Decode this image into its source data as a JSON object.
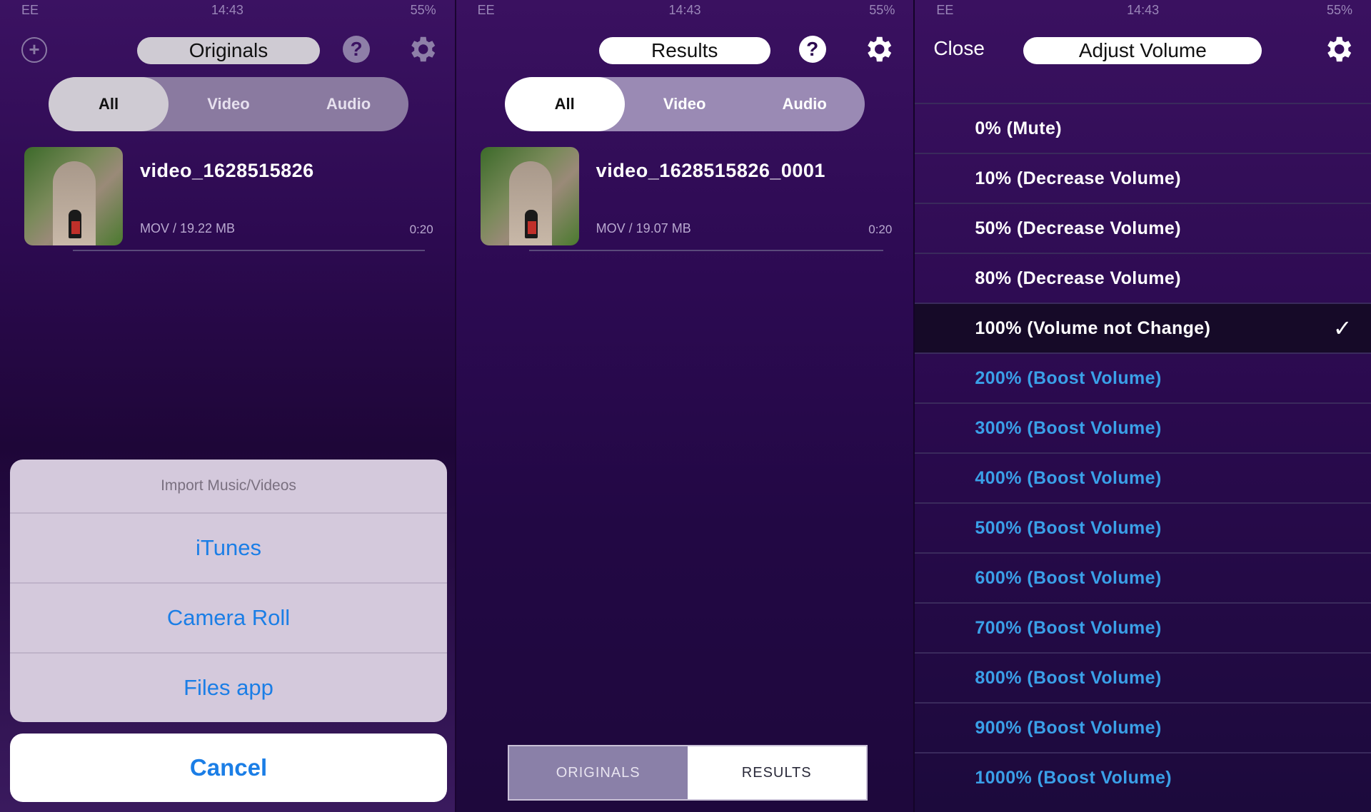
{
  "status_bar": {
    "carrier": "EE",
    "time": "14:43",
    "battery": "55%"
  },
  "panel1": {
    "title": "Originals",
    "add_icon": "plus-circle-icon",
    "help_icon": "question-circle-icon",
    "settings_icon": "gear-icon",
    "segments": [
      "All",
      "Video",
      "Audio"
    ],
    "media": {
      "name": "video_1628515826",
      "meta": "MOV / 19.22 MB",
      "duration": "0:20"
    },
    "action_sheet": {
      "title": "Import Music/Videos",
      "items": [
        "iTunes",
        "Camera Roll",
        "Files app"
      ],
      "cancel": "Cancel"
    }
  },
  "panel2": {
    "title": "Results",
    "help_icon": "question-circle-icon",
    "settings_icon": "gear-icon",
    "segments": [
      "All",
      "Video",
      "Audio"
    ],
    "media": {
      "name": "video_1628515826_0001",
      "meta": "MOV / 19.07 MB",
      "duration": "0:20"
    },
    "bottom_tabs": [
      "ORIGINALS",
      "RESULTS"
    ]
  },
  "panel3": {
    "close": "Close",
    "title": "Adjust Volume",
    "settings_icon": "gear-icon",
    "selected_index": 4,
    "check_icon": "checkmark-icon",
    "options": [
      "0% (Mute)",
      "10% (Decrease Volume)",
      "50% (Decrease Volume)",
      "80% (Decrease Volume)",
      "100% (Volume not Change)",
      "200% (Boost Volume)",
      "300% (Boost Volume)",
      "400% (Boost Volume)",
      "500% (Boost Volume)",
      "600% (Boost Volume)",
      "700% (Boost Volume)",
      "800% (Boost Volume)",
      "900% (Boost Volume)",
      "1000% (Boost Volume)"
    ]
  },
  "colors": {
    "ios_blue": "#1b7ee6",
    "boost_blue": "#3aa0e8",
    "white": "#ffffff"
  }
}
